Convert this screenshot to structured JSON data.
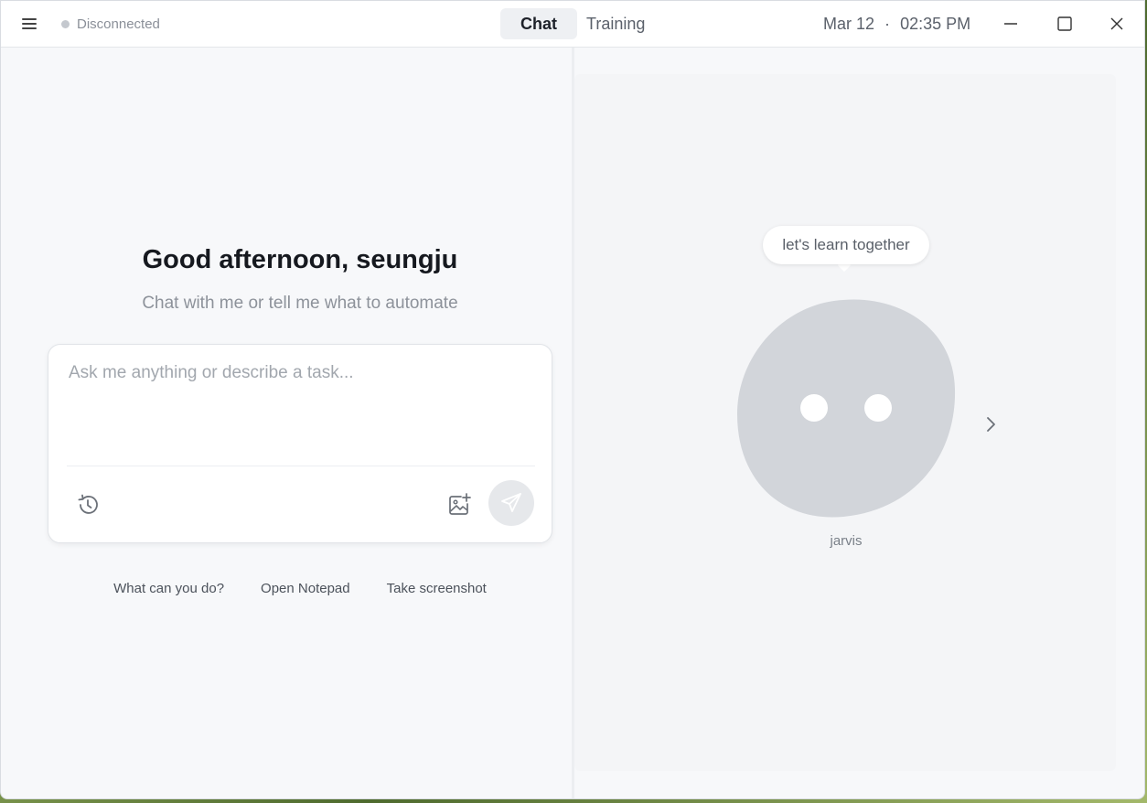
{
  "titlebar": {
    "status_text": "Disconnected",
    "tabs": [
      {
        "label": "Chat",
        "active": true
      },
      {
        "label": "Training",
        "active": false
      }
    ],
    "date": "Mar 12",
    "separator": "·",
    "time": "02:35 PM"
  },
  "chat": {
    "greeting": "Good afternoon, seungju",
    "subtitle": "Chat with me or tell me what to automate",
    "input_placeholder": "Ask me anything or describe a task...",
    "input_value": "",
    "suggestions": [
      "What can you do?",
      "Open Notepad",
      "Take screenshot"
    ]
  },
  "companion": {
    "bubble": "let's learn together",
    "name": "jarvis"
  },
  "colors": {
    "window_bg": "#f7f8fa",
    "status_dot": "#c4c8ce",
    "blob": "#d2d5da",
    "send_button_bg": "#e6e8eb"
  },
  "icons": [
    "menu-icon",
    "minimize-icon",
    "maximize-icon",
    "close-icon",
    "history-icon",
    "image-add-icon",
    "send-icon",
    "chevron-right-icon"
  ]
}
